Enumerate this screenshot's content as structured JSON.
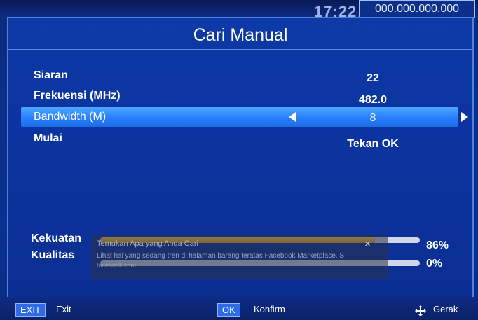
{
  "status": {
    "clock": "17:22",
    "number_display": "000.000.000.000"
  },
  "window": {
    "title": "Cari Manual"
  },
  "settings": [
    {
      "label": "Siaran",
      "value": "22"
    },
    {
      "label": "Frekuensi (MHz)",
      "value": "482.0"
    },
    {
      "label": "Bandwidth (M)",
      "value": "8"
    },
    {
      "label": "Mulai",
      "value": "Tekan OK"
    }
  ],
  "signal": {
    "strength": {
      "label": "Kekuatan",
      "percent_text": "86%",
      "fraction": 0.86
    },
    "quality": {
      "label": "Kualitas",
      "percent_text": "0%",
      "fraction": 0.0
    }
  },
  "notification": {
    "title": "Temukan Apa yang Anda Cari",
    "body": "Lihat hal yang sedang tren di halaman barang teratas Facebook Marketplace. S",
    "source": "facebook.com",
    "close_symbol": "✕"
  },
  "footer": {
    "exit_key": "EXIT",
    "exit_label": "Exit",
    "ok_key": "OK",
    "ok_label": "Konfirm",
    "move_label": "Gerak"
  },
  "colors": {
    "highlight": "#2a82ff",
    "strength_fill": "#e5a818",
    "track": "#cfd6e6"
  }
}
